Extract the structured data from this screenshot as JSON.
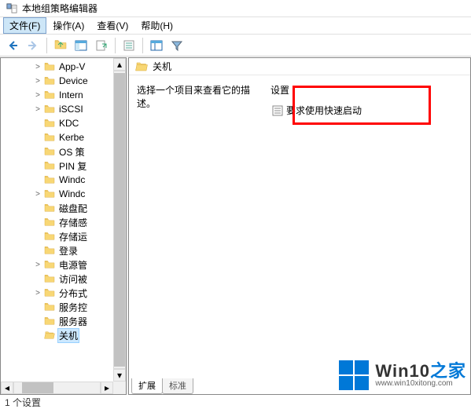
{
  "titlebar": {
    "title": "本地组策略编辑器"
  },
  "menubar": {
    "file": "文件(F)",
    "action": "操作(A)",
    "view": "查看(V)",
    "help": "帮助(H)"
  },
  "tree": {
    "items": [
      {
        "label": "App-V",
        "expander": ">"
      },
      {
        "label": "Device",
        "expander": ">"
      },
      {
        "label": "Intern",
        "expander": ">"
      },
      {
        "label": "iSCSI",
        "expander": ">"
      },
      {
        "label": "KDC",
        "expander": ""
      },
      {
        "label": "Kerbe",
        "expander": ""
      },
      {
        "label": "OS 策",
        "expander": ""
      },
      {
        "label": "PIN 复",
        "expander": ""
      },
      {
        "label": "Windc",
        "expander": ""
      },
      {
        "label": "Windc",
        "expander": ">"
      },
      {
        "label": "磁盘配",
        "expander": ""
      },
      {
        "label": "存储感",
        "expander": ""
      },
      {
        "label": "存储运",
        "expander": ""
      },
      {
        "label": "登录",
        "expander": ""
      },
      {
        "label": "电源管",
        "expander": ">"
      },
      {
        "label": "访问被",
        "expander": ""
      },
      {
        "label": "分布式",
        "expander": ">"
      },
      {
        "label": "服务控",
        "expander": ""
      },
      {
        "label": "服务器",
        "expander": ""
      },
      {
        "label": "关机",
        "expander": "",
        "selected": true
      }
    ]
  },
  "content": {
    "header_title": "关机",
    "description_prompt": "选择一个项目来查看它的描述。",
    "settings_header": "设置",
    "settings_item": "要求使用快速启动"
  },
  "tabs": {
    "extended": "扩展",
    "standard": "标准"
  },
  "statusbar": {
    "text": "1 个设置"
  },
  "watermark": {
    "brand": "Win10",
    "suffix": "之家",
    "url": "www.win10xitong.com"
  }
}
